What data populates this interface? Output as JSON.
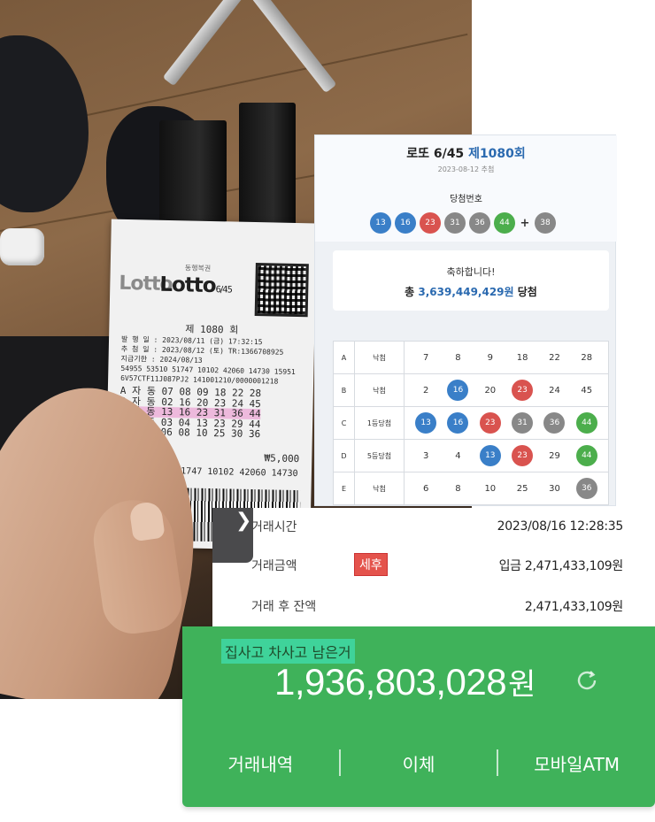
{
  "ticket": {
    "brand_lotto": "Lotto",
    "brand_lotto645": "Lotto",
    "brand_suffix": "6/45",
    "issuer": "동행복권",
    "draw": "제 1080 회",
    "meta_lines": [
      "발 행 일 : 2023/08/11 (금) 17:32:15",
      "추 첨 일 : 2023/08/12 (토) TR:1366708925",
      "지급기한 : 2024/08/13",
      "54955 53510 51747 10102 42060 14730 15951",
      "6V57CTF11J087PJ2     141001210/0000001218"
    ],
    "rows": [
      "A 자 동 07 08 09 18 22 28",
      "B 자 동 02 16 20 23 24 45",
      "C 자 동 13 16 23 31 36 44",
      "D 자 동 03 04 13 23 29 44",
      "E 자 동 06 08 10 25 30 36"
    ],
    "amount_label": "금액",
    "amount": "₩5,000",
    "barcode_number": "54955 53510 51747 10102 42060 14730 15951"
  },
  "lotto": {
    "title_prefix": "로또 6/45 ",
    "round": "제1080회",
    "date": "2023-08-12 추첨",
    "winning_label": "당첨번호",
    "winning_numbers": [
      {
        "n": "13",
        "color": "#3a7fc8"
      },
      {
        "n": "16",
        "color": "#3a7fc8"
      },
      {
        "n": "23",
        "color": "#d9534f"
      },
      {
        "n": "31",
        "color": "#888888"
      },
      {
        "n": "36",
        "color": "#888888"
      },
      {
        "n": "44",
        "color": "#4cae4c"
      }
    ],
    "plus": "+",
    "bonus": {
      "n": "38",
      "color": "#888888"
    },
    "congrats": "축하합니다!",
    "prize_prefix": "총 ",
    "prize_amount": "3,639,449,429원",
    "prize_suffix": " 당첨",
    "rows": [
      {
        "line": "A",
        "result": "낙첨",
        "nums": [
          {
            "n": "7"
          },
          {
            "n": "8"
          },
          {
            "n": "9"
          },
          {
            "n": "18"
          },
          {
            "n": "22"
          },
          {
            "n": "28"
          }
        ]
      },
      {
        "line": "B",
        "result": "낙첨",
        "nums": [
          {
            "n": "2"
          },
          {
            "n": "16",
            "c": "#3a7fc8"
          },
          {
            "n": "20"
          },
          {
            "n": "23",
            "c": "#d9534f"
          },
          {
            "n": "24"
          },
          {
            "n": "45"
          }
        ]
      },
      {
        "line": "C",
        "result": "1등당첨",
        "nums": [
          {
            "n": "13",
            "c": "#3a7fc8"
          },
          {
            "n": "16",
            "c": "#3a7fc8"
          },
          {
            "n": "23",
            "c": "#d9534f"
          },
          {
            "n": "31",
            "c": "#888888"
          },
          {
            "n": "36",
            "c": "#888888"
          },
          {
            "n": "44",
            "c": "#4cae4c"
          }
        ]
      },
      {
        "line": "D",
        "result": "5등당첨",
        "nums": [
          {
            "n": "3"
          },
          {
            "n": "4"
          },
          {
            "n": "13",
            "c": "#3a7fc8"
          },
          {
            "n": "23",
            "c": "#d9534f"
          },
          {
            "n": "29"
          },
          {
            "n": "44",
            "c": "#4cae4c"
          }
        ]
      },
      {
        "line": "E",
        "result": "낙첨",
        "nums": [
          {
            "n": "6"
          },
          {
            "n": "8"
          },
          {
            "n": "10"
          },
          {
            "n": "25"
          },
          {
            "n": "30"
          },
          {
            "n": "36",
            "c": "#888888"
          }
        ]
      }
    ]
  },
  "transaction": {
    "tab_glyph": "❯",
    "time_label": "거래시간",
    "time_value": "2023/08/16 12:28:35",
    "amount_label": "거래금액",
    "after_tax_badge": "세후",
    "amount_value": "입금 2,471,433,109원",
    "balance_label": "거래 후 잔액",
    "balance_value": "2,471,433,109원"
  },
  "bank": {
    "account_name": "집사고 차사고 남은거",
    "balance": "1,936,803,028",
    "balance_unit": "원",
    "refresh_icon": "refresh-icon",
    "actions": [
      "거래내역",
      "이체",
      "모바일ATM"
    ],
    "accent": "#3fb25a"
  }
}
